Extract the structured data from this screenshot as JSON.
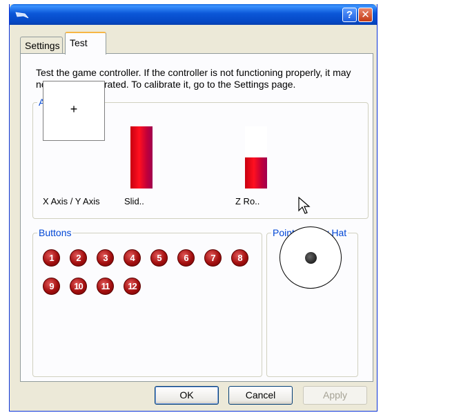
{
  "window": {
    "help_glyph": "?",
    "close_glyph": "✕"
  },
  "tabs": [
    {
      "label": "Settings"
    },
    {
      "label": "Test"
    }
  ],
  "description": "Test the game controller.  If the controller is not functioning properly, it may need to be calibrated.  To calibrate it, go to the Settings page.",
  "axes": {
    "legend": "Axes",
    "xy_label": "X Axis / Y Axis",
    "crosshair": "+",
    "slider_label": "Slid..",
    "slider_level": 1.0,
    "zrot_label": "Z Ro..",
    "zrot_level": 0.5
  },
  "buttons_group": {
    "legend": "Buttons",
    "buttons": [
      "1",
      "2",
      "3",
      "4",
      "5",
      "6",
      "7",
      "8",
      "9",
      "10",
      "11",
      "12"
    ]
  },
  "pov": {
    "legend": "Point of View Hat"
  },
  "dialog_buttons": {
    "ok": "OK",
    "cancel": "Cancel",
    "apply": "Apply"
  },
  "colors": {
    "title_bar": "#0b57d8",
    "group_label": "#0046d5",
    "axis_bar": "#e0001a",
    "button_fill": "#a30f0f"
  }
}
